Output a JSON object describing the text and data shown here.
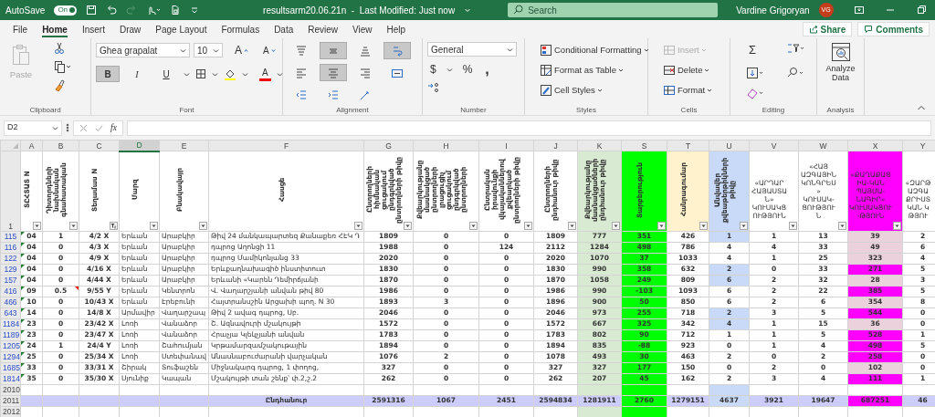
{
  "title_bar": {
    "autosave_label": "AutoSave",
    "autosave_on": true,
    "autosave_state": "On",
    "redo_disabled": true,
    "document_title": "resultsarm20.06.21n  -  Last Modified: Just now",
    "search_placeholder": "Search",
    "user_name": "Vardine Grigoryan",
    "user_initials": "VG"
  },
  "menu_tabs": [
    {
      "label": "File",
      "selected": false
    },
    {
      "label": "Home",
      "selected": true
    },
    {
      "label": "Insert",
      "selected": false
    },
    {
      "label": "Draw",
      "selected": false
    },
    {
      "label": "Page Layout",
      "selected": false
    },
    {
      "label": "Formulas",
      "selected": false
    },
    {
      "label": "Data",
      "selected": false
    },
    {
      "label": "Review",
      "selected": false
    },
    {
      "label": "View",
      "selected": false
    },
    {
      "label": "Help",
      "selected": false
    }
  ],
  "share_label": "Share",
  "comments_label": "Comments",
  "ribbon": {
    "clipboard": {
      "paste_label": "Paste",
      "paste_disabled": true,
      "group_label": "Clipboard"
    },
    "font": {
      "font_name": "Ghea grapalat",
      "font_size": "10",
      "grow_glyph": "A",
      "shrink_glyph": "A",
      "bold_glyph": "B",
      "bold_on": true,
      "italic_glyph": "I",
      "italic_on": false,
      "underline_glyph": "U",
      "underline_on": false,
      "font_color_glyph": "A",
      "group_label": "Font"
    },
    "alignment": {
      "group_label": "Alignment",
      "buttons": [
        {
          "kind": "top",
          "selected": false
        },
        {
          "kind": "middle",
          "selected": true
        },
        {
          "kind": "bottom",
          "selected": false
        },
        {
          "kind": "wrap",
          "selected": true
        },
        {
          "kind": "left",
          "selected": false
        },
        {
          "kind": "center",
          "selected": true
        },
        {
          "kind": "right",
          "selected": false
        },
        {
          "kind": "merge",
          "selected": false
        },
        {
          "kind": "outdent",
          "selected": false
        },
        {
          "kind": "indent",
          "selected": false
        },
        {
          "kind": "orientation",
          "selected": false
        }
      ]
    },
    "number": {
      "format": "General",
      "currency_glyph": "$",
      "percent_glyph": "%",
      "comma_glyph": ",",
      "group_label": "Number"
    },
    "styles": {
      "group_label": "Styles",
      "items": [
        {
          "kind": "conditional",
          "label": "Conditional Formatting"
        },
        {
          "kind": "table",
          "label": "Format as Table"
        },
        {
          "kind": "cellstyles",
          "label": "Cell Styles"
        }
      ]
    },
    "cells": {
      "group_label": "Cells",
      "items": [
        {
          "kind": "insert",
          "label": "Insert",
          "disabled": true
        },
        {
          "kind": "delete",
          "label": "Delete",
          "disabled": false
        },
        {
          "kind": "format",
          "label": "Format",
          "disabled": false
        }
      ]
    },
    "editing": {
      "group_label": "Editing",
      "sum_glyph": "Σ"
    },
    "analysis": {
      "button_label": "Analyze Data",
      "group_label": "Analysis"
    }
  },
  "formula_bar": {
    "name_box": "D2",
    "fx_label": "fx"
  },
  "sheet": {
    "header_row": "1",
    "columns": [
      {
        "letter": "A",
        "header": "ՏԸՀՏԱՏ N",
        "kind": "rotated",
        "selected": false,
        "filtered": false,
        "tint_column": false,
        "blank_tint": false
      },
      {
        "letter": "B",
        "header": "Դիտորդների նախնական գնահատական",
        "kind": "rotated",
        "selected": false,
        "filtered": false,
        "tint_column": false,
        "blank_tint": false
      },
      {
        "letter": "C",
        "header": "Տեղամաս N",
        "kind": "rotated",
        "selected": false,
        "filtered": true,
        "tint_column": false,
        "blank_tint": false
      },
      {
        "letter": "D",
        "header": "Մարզ",
        "kind": "rotated",
        "selected": true,
        "filtered": false,
        "tint_column": false,
        "blank_tint": false
      },
      {
        "letter": "E",
        "header": "Բնակավայր",
        "kind": "rotated",
        "selected": false,
        "filtered": false,
        "tint_column": false,
        "blank_tint": false
      },
      {
        "letter": "F",
        "header": "Հասցե",
        "kind": "rotated",
        "selected": false,
        "filtered": false,
        "tint_column": false,
        "blank_tint": false
      },
      {
        "letter": "G",
        "header": "Ընտրողների հիմնական ցուցակում ընդգրկված ընտրողների թիվը",
        "kind": "rotated",
        "selected": false,
        "filtered": false,
        "tint_column": false,
        "blank_tint": false
      },
      {
        "letter": "H",
        "header": "Քվեարկությանը մասնակցած ընտրողների լրացուցիչ ցուցակում ընդգրկված ընտրողների",
        "kind": "rotated",
        "selected": false,
        "filtered": false,
        "tint_column": false,
        "blank_tint": false
      },
      {
        "letter": "I",
        "header": "Ընտրական իրավունքի վկայականներով քվեարկած ընտրողների թիվը",
        "kind": "rotated",
        "selected": false,
        "filtered": false,
        "tint_column": false,
        "blank_tint": false
      },
      {
        "letter": "J",
        "header": "Ընտրողների ընդհանուր թիվը",
        "kind": "rotated",
        "selected": false,
        "filtered": false,
        "tint_column": false,
        "blank_tint": false
      },
      {
        "letter": "K",
        "header": "Քվեարկությանը մասնակցածների ընդհանուր թիվը",
        "kind": "rotated",
        "selected": false,
        "filtered": false,
        "color": "#d9ead3",
        "tint_column": true,
        "blank_tint": false
      },
      {
        "letter": "S",
        "header": "Տարբերություն",
        "kind": "rotated",
        "selected": false,
        "filtered": false,
        "color": "#00ff00",
        "tint_column": true,
        "blank_tint": false
      },
      {
        "letter": "T",
        "header": "Հանրագումար",
        "kind": "rotated",
        "selected": false,
        "filtered": false,
        "color": "#fff2cc",
        "tint_column": false,
        "blank_tint": false
      },
      {
        "letter": "U",
        "header": "Անվավեր քվեաթերթիկների թիվը",
        "kind": "rotated",
        "selected": false,
        "filtered": false,
        "color": "#c9daf8",
        "tint_column": false,
        "blank_tint": true
      },
      {
        "letter": "V",
        "header": "«ԱՐԴԱՐ ՀԱՅԱՍՏԱՆ» ԿՈՒՍԱԿՑՈՒԹՅՈՒՆ",
        "kind": "flat",
        "selected": false,
        "filtered": false,
        "tint_column": false,
        "blank_tint": false
      },
      {
        "letter": "W",
        "header": "«ՀԱՅ ԱԶԳԱՅԻՆ ԿՈՆԳՐԵՍ» ԿՈՒՍԱԿ-ՑՈՒԹՅՈՒՆ",
        "kind": "flat",
        "selected": false,
        "filtered": false,
        "tint_column": false,
        "blank_tint": false
      },
      {
        "letter": "X",
        "header": "«ՔԱՂԱՔԱՑԻԱ-ԿԱՆ ՊԱՅՄԱ-ՆԱԳԻՐ» ԿՈՒՍԱԿՑՈՒ-ԹՅՈՒՆ",
        "kind": "flat",
        "selected": false,
        "filtered": false,
        "color": "#ff00ff",
        "tint_column": false,
        "blank_tint": false
      },
      {
        "letter": "Y",
        "header": "«ԶԱՐԹ ԱԶԳԱ ՔՐԻՍՏ ԿԱՆ Կ ԹՅՈՒ",
        "kind": "flat",
        "selected": false,
        "tint_column": false,
        "blank_tint": false
      }
    ],
    "rows": [
      {
        "row": "115",
        "flagged": true,
        "b_comment": false,
        "cells": [
          "04",
          "1",
          "4/2 X",
          "Երևան",
          "Արաբկիր",
          "Թիվ 24 մանկապարտեզ Քանաքեռ ՀԷԿ Դ",
          "1809",
          "0",
          "0",
          "1809",
          "777",
          "351",
          "426",
          {
            "text": "1",
            "color": "#c9daf8"
          },
          "1",
          "13",
          {
            "text": "39",
            "color": "#ead1dc"
          },
          "2"
        ]
      },
      {
        "row": "116",
        "flagged": true,
        "b_comment": false,
        "cells": [
          "04",
          "0",
          "4/3 X",
          "Երևան",
          "Արաբկիր",
          "դպրոց Աղոնցի 11",
          "1988",
          "0",
          "124",
          "2112",
          "1284",
          "498",
          "786",
          "4",
          "4",
          "33",
          {
            "text": "49",
            "color": "#ead1dc"
          },
          "6"
        ]
      },
      {
        "row": "122",
        "flagged": true,
        "b_comment": false,
        "cells": [
          "04",
          "0",
          "4/9 X",
          "Երևան",
          "Արաբկիր",
          "դպրոց Մամիկոնյանց 33",
          "2020",
          "0",
          "0",
          "2020",
          "1070",
          "37",
          "1033",
          "4",
          "1",
          "25",
          {
            "text": "323",
            "color": "#ead1dc"
          },
          "4"
        ]
      },
      {
        "row": "129",
        "flagged": true,
        "b_comment": false,
        "cells": [
          "04",
          "0",
          "4/16 X",
          "Երևան",
          "Արաբկիր",
          "Երևքաղնախագիծ ինստիտուտ",
          "1830",
          "0",
          "0",
          "1830",
          "990",
          "358",
          "632",
          {
            "text": "2",
            "color": "#c9daf8"
          },
          "0",
          "33",
          {
            "text": "271",
            "color": "#ff00ff"
          },
          "5"
        ]
      },
      {
        "row": "157",
        "flagged": true,
        "b_comment": false,
        "cells": [
          "04",
          "0",
          "4/44 X",
          "Երևան",
          "Արաբկիր",
          "Երևանի «Կարեն Դեմիրճյանի",
          "1870",
          "0",
          "0",
          "1870",
          "1058",
          "249",
          "809",
          {
            "text": "6",
            "color": "#c9daf8"
          },
          "2",
          "32",
          {
            "text": "28",
            "color": "#ead1dc"
          },
          "3"
        ]
      },
      {
        "row": "416",
        "flagged": true,
        "b_comment": true,
        "cells": [
          "09",
          "0.5",
          "9/55 Y",
          "Երևան",
          "Կենտրոն",
          "Վ. Վաղարշյանի անվան թիվ 80",
          "1986",
          "0",
          "0",
          "1986",
          "990",
          "-103",
          "1093",
          "6",
          "2",
          "22",
          {
            "text": "385",
            "color": "#ff00ff"
          },
          "5"
        ]
      },
      {
        "row": "466",
        "flagged": true,
        "b_comment": false,
        "cells": [
          "10",
          "0",
          "10/43 X",
          "Երևան",
          "Էրեբունի",
          "Հայտրանսշին Արցախի պող. N 30",
          "1893",
          "3",
          "0",
          "1896",
          "900",
          "50",
          "850",
          "6",
          "2",
          "6",
          {
            "text": "354",
            "color": "#ead1dc"
          },
          "8"
        ]
      },
      {
        "row": "643",
        "flagged": true,
        "b_comment": false,
        "cells": [
          "14",
          "0",
          "14/8 X",
          "Արմավիր",
          "Վաղարշապ",
          "Թիվ 2 ավագ դպրոց, Սբ.",
          "2046",
          "0",
          "0",
          "2046",
          "973",
          "255",
          "718",
          {
            "text": "2",
            "color": "#c9daf8"
          },
          "3",
          "5",
          {
            "text": "544",
            "color": "#ff00ff"
          },
          "0"
        ]
      },
      {
        "row": "1184",
        "flagged": true,
        "b_comment": false,
        "cells": [
          "23",
          "0",
          "23/42 X",
          "Լոռի",
          "Վանաձոր",
          "Շ. Ազնավուրի մշակույթի",
          "1572",
          "0",
          "0",
          "1572",
          "667",
          "325",
          "342",
          {
            "text": "4",
            "color": "#c9daf8"
          },
          "1",
          "15",
          {
            "text": "36",
            "color": "#ead1dc"
          },
          "0"
        ]
      },
      {
        "row": "1189",
        "flagged": true,
        "b_comment": false,
        "cells": [
          "23",
          "0",
          "23/47 X",
          "Լոռի",
          "Վանաձոր",
          "Հրաչյա Կլեկչյանի անվան",
          "1783",
          "0",
          "0",
          "1783",
          "802",
          "90",
          "712",
          "1",
          "1",
          "5",
          {
            "text": "528",
            "color": "#ff00ff"
          },
          "1"
        ]
      },
      {
        "row": "1205",
        "flagged": true,
        "b_comment": false,
        "cells": [
          "24",
          "1",
          "24/4 Y",
          "Լոռի",
          "Շահումյան",
          "Կրթամարզամշակութային",
          "1894",
          "0",
          "0",
          "1894",
          "835",
          "-88",
          "923",
          "0",
          "1",
          "4",
          {
            "text": "498",
            "color": "#ff00ff"
          },
          "5"
        ]
      },
      {
        "row": "1294",
        "flagged": true,
        "b_comment": false,
        "cells": [
          "25",
          "0",
          "25/34 X",
          "Լոռի",
          "Ստեփանավ",
          "Անասնաբուժարանի վարչական",
          "1076",
          "2",
          "0",
          "1078",
          "493",
          "30",
          "463",
          "2",
          "0",
          "2",
          {
            "text": "258",
            "color": "#ff00ff"
          },
          "0"
        ]
      },
      {
        "row": "1685",
        "flagged": true,
        "b_comment": false,
        "cells": [
          "33",
          "0",
          "33/31 X",
          "Շիրակ",
          "Տուֆաշեն",
          "Միջնակարգ դպրոց, 1 փողոց,",
          "327",
          "0",
          "0",
          "327",
          "327",
          "177",
          "150",
          "0",
          "2",
          "0",
          {
            "text": "102",
            "color": "#ead1dc"
          },
          "0"
        ]
      },
      {
        "row": "1814",
        "flagged": true,
        "b_comment": false,
        "cells": [
          "35",
          "0",
          "35/30 X",
          "Սյունիք",
          "Կապան",
          "Մշակույթի տան շենք՝ փ.2,շ.2",
          "262",
          "0",
          "0",
          "262",
          "207",
          "45",
          "162",
          "2",
          "3",
          "4",
          {
            "text": "111",
            "color": "#ff00ff"
          },
          "1"
        ]
      }
    ],
    "footer_rows": [
      {
        "row": "2010",
        "kind": "blank",
        "color": "#c9daf8"
      },
      {
        "row": "2011",
        "kind": "total",
        "label": "Ընդհանուր",
        "color": "#ccccff",
        "values": [
          {
            "text": "2591316",
            "color": "#ccccff"
          },
          {
            "text": "1067",
            "color": "#ccccff"
          },
          {
            "text": "2451",
            "color": "#ccccff"
          },
          {
            "text": "2594834",
            "color": "#ccccff"
          },
          {
            "text": "1281911",
            "color": "#ccccff"
          },
          {
            "text": "2760",
            "color": "#00ff00"
          },
          {
            "text": "1279151",
            "color": "#ccccff"
          },
          {
            "text": "4637",
            "color": "#c9daf8"
          },
          {
            "text": "3921",
            "color": "#ccccff"
          },
          {
            "text": "19647",
            "color": "#ccccff"
          },
          {
            "text": "687251",
            "color": "#ff00ff"
          },
          {
            "text": "46",
            "color": "#ccccff"
          }
        ]
      },
      {
        "row": "2012",
        "kind": "blank"
      }
    ]
  }
}
